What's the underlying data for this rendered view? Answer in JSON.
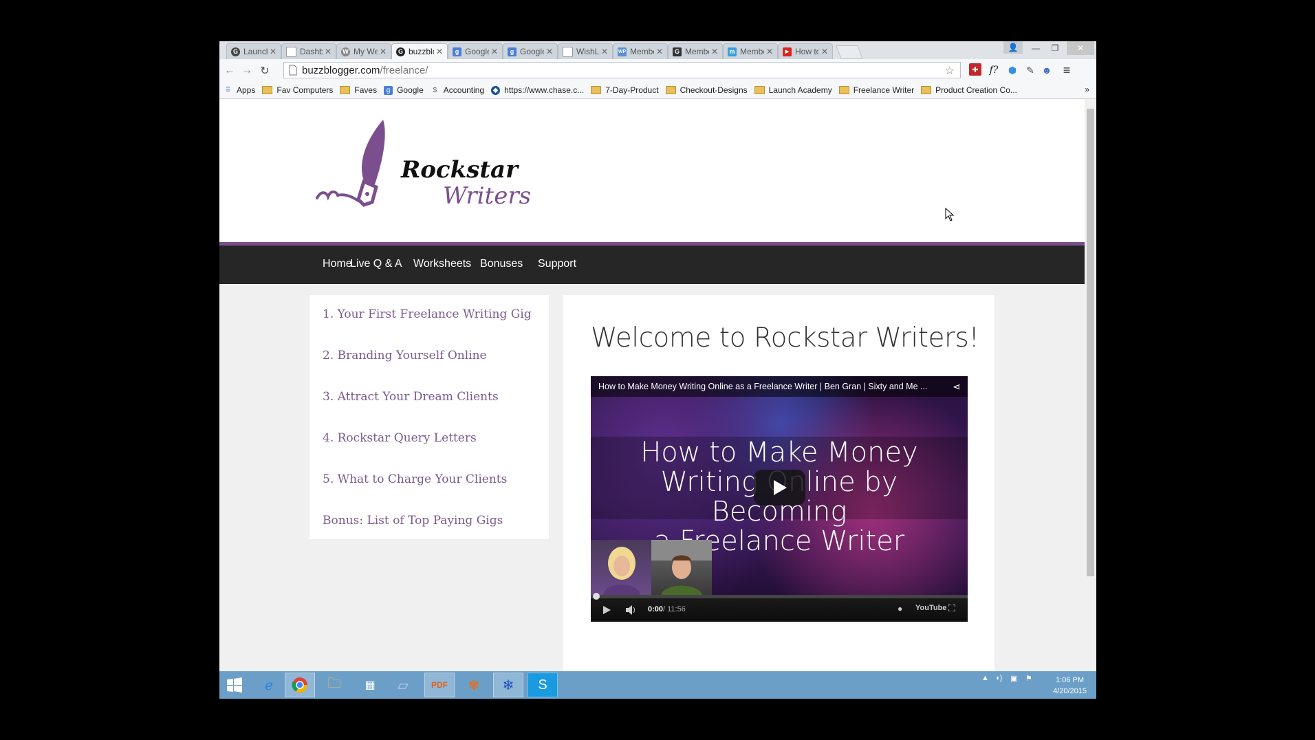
{
  "browser": {
    "tabs": [
      {
        "label": "Launchi",
        "icon": "g-icon",
        "active": false
      },
      {
        "label": "Dashbo",
        "icon": "page-icon",
        "active": false
      },
      {
        "label": "My Web",
        "icon": "wordpress-icon",
        "active": false
      },
      {
        "label": "buzzblo",
        "icon": "g-icon",
        "active": true
      },
      {
        "label": "Google",
        "icon": "google-icon",
        "active": false
      },
      {
        "label": "Google",
        "icon": "google-icon",
        "active": false
      },
      {
        "label": "WishLis",
        "icon": "page-icon",
        "active": false
      },
      {
        "label": "Membe",
        "icon": "wlp-icon",
        "active": false
      },
      {
        "label": "Membe",
        "icon": "g-icon",
        "active": false
      },
      {
        "label": "Membe",
        "icon": "m-icon",
        "active": false
      },
      {
        "label": "How to",
        "icon": "youtube-icon",
        "active": false
      }
    ],
    "url_domain": "buzzblogger.com",
    "url_path": "/freelance/",
    "bookmarks": [
      {
        "label": "Apps",
        "icon": "apps-icon"
      },
      {
        "label": "Fav Computers",
        "icon": "folder-icon"
      },
      {
        "label": "Faves",
        "icon": "folder-icon"
      },
      {
        "label": "Google",
        "icon": "google-icon"
      },
      {
        "label": "Accounting",
        "icon": "accounting-icon"
      },
      {
        "label": "https://www.chase.c...",
        "icon": "chase-icon"
      },
      {
        "label": "7-Day-Product",
        "icon": "folder-icon"
      },
      {
        "label": "Checkout-Designs",
        "icon": "folder-icon"
      },
      {
        "label": "Launch Academy",
        "icon": "folder-icon"
      },
      {
        "label": "Freelance Writer",
        "icon": "folder-icon"
      },
      {
        "label": "Product Creation Co...",
        "icon": "folder-icon"
      }
    ],
    "more_bookmarks": "»"
  },
  "site": {
    "logo_line1": "Rockstar",
    "logo_line2": "Writers",
    "brand_color": "#7b4f8e",
    "nav": [
      "Home",
      "Live Q & A",
      "Worksheets",
      "Bonuses",
      "Support"
    ],
    "sidebar": [
      "1. Your First Freelance Writing Gig",
      "2. Branding Yourself Online",
      "3. Attract Your Dream Clients",
      "4. Rockstar Query Letters",
      "5. What to Charge Your Clients",
      "Bonus: List of Top Paying Gigs"
    ],
    "heading": "Welcome to Rockstar Writers!"
  },
  "video": {
    "top_title": "How to Make Money Writing Online as a Freelance Writer | Ben Gran | Sixty and Me ...",
    "title_lines": [
      "How to Make Money",
      "Writing Online by Becoming",
      "a Freelance Writer"
    ],
    "time_current": "0:00",
    "time_total": "/ 11:56",
    "progress_fraction": 0,
    "youtube_label": "YouTube"
  },
  "taskbar": {
    "time": "1:06 PM",
    "date": "4/20/2015"
  }
}
